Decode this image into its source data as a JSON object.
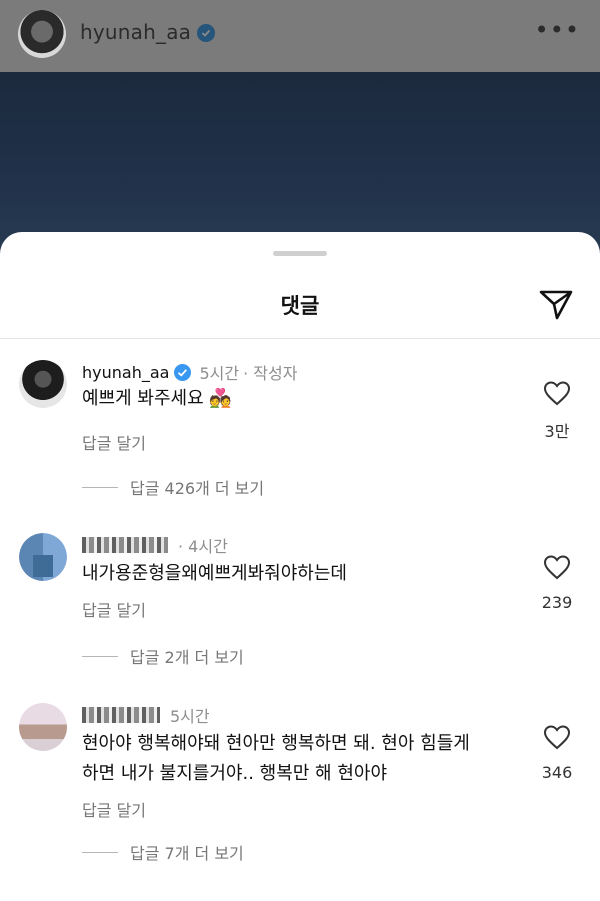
{
  "header": {
    "username": "hyunah_aa",
    "more_label": "•••"
  },
  "sheet": {
    "title": "댓글"
  },
  "comments": [
    {
      "username": "hyunah_aa",
      "time": "5시간",
      "meta_suffix": "· 작성자",
      "text": "예쁘게 봐주세요",
      "emoji": "💑",
      "reply_label": "답글 달기",
      "likes": "3만",
      "view_replies": "답글 426개 더 보기"
    },
    {
      "username": "",
      "time": "· 4시간",
      "meta_suffix": "",
      "text": "내가용준형을왜예쁘게봐줘야하는데",
      "reply_label": "답글 달기",
      "likes": "239",
      "view_replies": "답글 2개 더 보기"
    },
    {
      "username": "",
      "time": "5시간",
      "meta_suffix": "",
      "text_line1": "현아야 행복해야돼 현아만 행복하면 돼. 현아 힘들게",
      "text_line2": "하면 내가 불지를거야.. 행복만 해 현아야",
      "reply_label": "답글 달기",
      "likes": "346",
      "view_replies": "답글 7개 더 보기"
    }
  ],
  "colors": {
    "verified": "#3897f0",
    "muted": "#8e8e8e"
  },
  "icons": [
    "verified-badge-icon",
    "more-icon",
    "share-icon",
    "heart-icon"
  ]
}
